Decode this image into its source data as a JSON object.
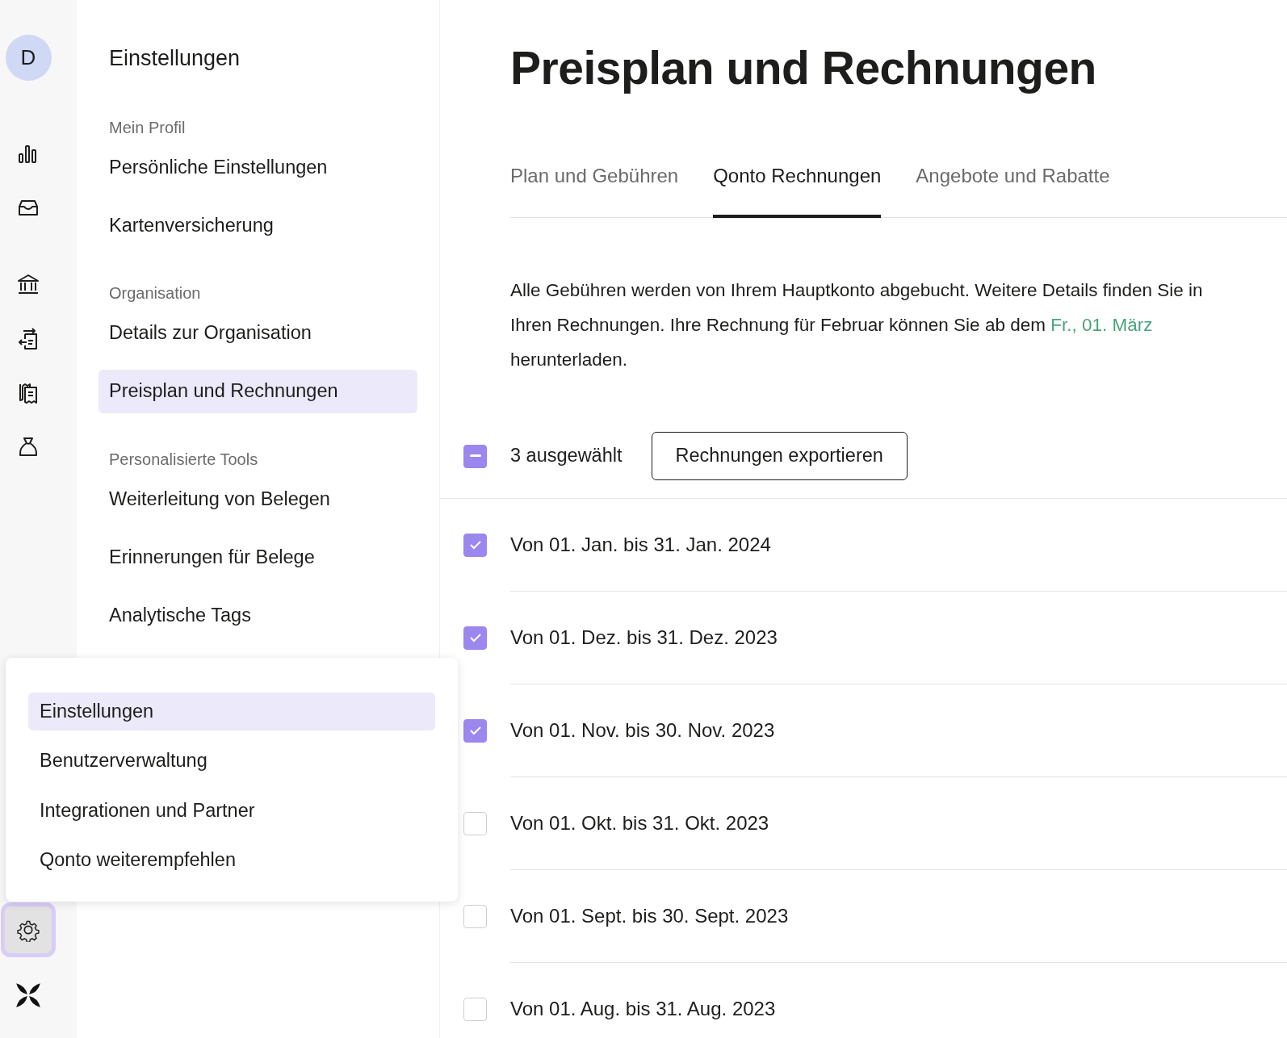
{
  "rail": {
    "avatar_initial": "D",
    "settings_button": {
      "active": true
    }
  },
  "settings_nav": {
    "title": "Einstellungen",
    "sections": [
      {
        "heading": "Mein Profil",
        "items": [
          {
            "label": "Persönliche Einstellungen",
            "selected": false
          },
          {
            "label": "Kartenversicherung",
            "selected": false
          }
        ]
      },
      {
        "heading": "Organisation",
        "items": [
          {
            "label": "Details zur Organisation",
            "selected": false
          },
          {
            "label": "Preisplan und Rechnungen",
            "selected": true
          }
        ]
      },
      {
        "heading": "Personalisierte Tools",
        "items": [
          {
            "label": "Weiterleitung von Belegen",
            "selected": false
          },
          {
            "label": "Erinnerungen für Belege",
            "selected": false
          },
          {
            "label": "Analytische Tags",
            "selected": false
          }
        ]
      }
    ]
  },
  "popup_menu": {
    "items": [
      {
        "label": "Einstellungen",
        "selected": true
      },
      {
        "label": "Benutzerverwaltung",
        "selected": false
      },
      {
        "label": "Integrationen und Partner",
        "selected": false
      },
      {
        "label": "Qonto weiterempfehlen",
        "selected": false
      }
    ]
  },
  "page_title": "Preisplan und Rechnungen",
  "tabs": [
    {
      "label": "Plan und Gebühren",
      "selected": false
    },
    {
      "label": "Qonto Rechnungen",
      "selected": true
    },
    {
      "label": "Angebote und Rabatte",
      "selected": false
    }
  ],
  "info": {
    "text": "Alle Gebühren werden von Ihrem Hauptkonto abgebucht. Weitere Details finden Sie in Ihren Rechnungen. Ihre Rechnung für Februar können Sie ab dem",
    "link": "Fr., 01. März",
    "text_after": "herunterladen."
  },
  "selection_bar": {
    "indeterminate": true,
    "count_label": "3 ausgewählt",
    "export_button": "Rechnungen exportieren"
  },
  "invoices": [
    {
      "label": "Von 01. Jan. bis 31. Jan. 2024",
      "checked": true
    },
    {
      "label": "Von 01. Dez. bis 31. Dez. 2023",
      "checked": true
    },
    {
      "label": "Von 01. Nov. bis 30. Nov. 2023",
      "checked": true
    },
    {
      "label": "Von 01. Okt. bis 31. Okt. 2023",
      "checked": false
    },
    {
      "label": "Von 01. Sept. bis 30. Sept. 2023",
      "checked": false
    },
    {
      "label": "Von 01. Aug. bis 31. Aug. 2023",
      "checked": false
    }
  ]
}
